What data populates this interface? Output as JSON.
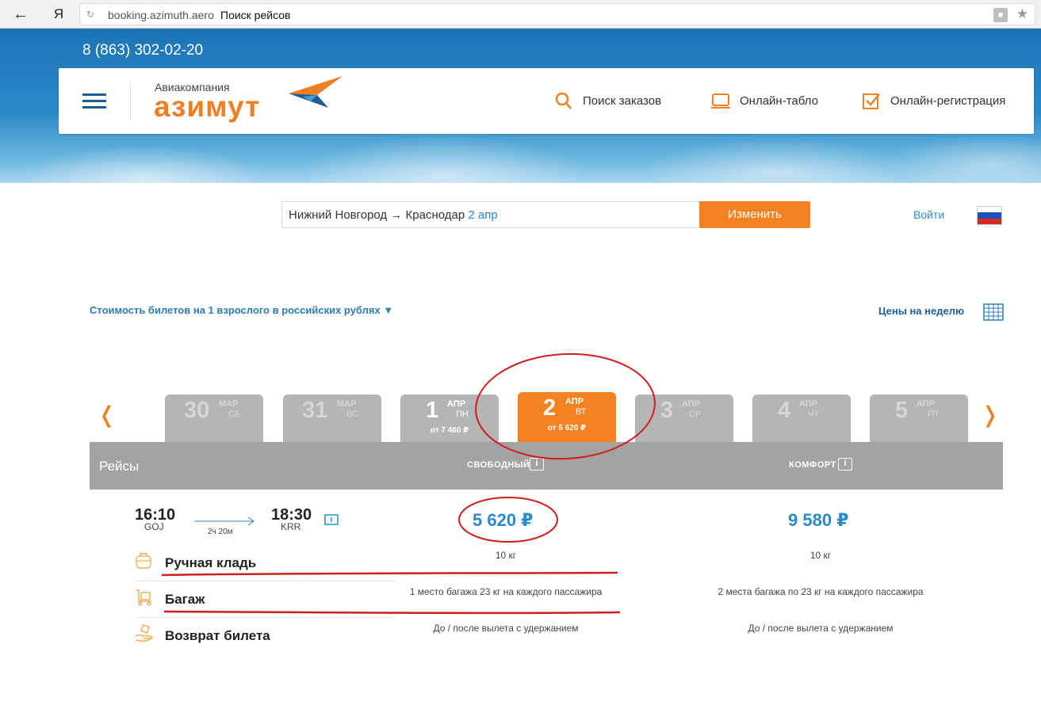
{
  "browser": {
    "back_icon": "arrow-left-icon",
    "yandex_label": "Я",
    "url_domain": "booking.azimuth.aero",
    "url_title": "Поиск рейсов"
  },
  "header": {
    "phone": "8 (863) 302-02-20",
    "logo_small": "Авиакомпания",
    "logo_big": "азимут",
    "nav": [
      {
        "label": "Поиск заказов",
        "icon": "search-icon"
      },
      {
        "label": "Онлайн-табло",
        "icon": "monitor-icon"
      },
      {
        "label": "Онлайн-регистрация",
        "icon": "checkbox-icon"
      }
    ]
  },
  "search": {
    "route": "Нижний Новгород → Краснодар",
    "date": "2 апр",
    "change_label": "Изменить",
    "login_label": "Войти"
  },
  "prices_note": "Стоимость билетов на 1 взрослого в российских рублях",
  "prices_note_arrow": "▼",
  "week_prices_label": "Цены на неделю",
  "nav_arrows": {
    "left": "❬",
    "right": "❭"
  },
  "dates": [
    {
      "day": "30",
      "month": "МАР",
      "weekday": "СБ",
      "price": ""
    },
    {
      "day": "31",
      "month": "МАР",
      "weekday": "ВС",
      "price": ""
    },
    {
      "day": "1",
      "month": "АПР",
      "weekday": "ПН",
      "price": "от 7 460 ₽"
    },
    {
      "day": "2",
      "month": "АПР",
      "weekday": "ВТ",
      "price": "от 5 620 ₽"
    },
    {
      "day": "3",
      "month": "АПР",
      "weekday": "СР",
      "price": ""
    },
    {
      "day": "4",
      "month": "АПР",
      "weekday": "ЧТ",
      "price": ""
    },
    {
      "day": "5",
      "month": "АПР",
      "weekday": "ПТ",
      "price": ""
    }
  ],
  "table": {
    "flights_label": "Рейсы",
    "free_label": "СВОБОДНЫЙ",
    "comfort_label": "КОМФОРТ",
    "info_glyph": "i"
  },
  "flight": {
    "dep_time": "16:10",
    "dep_code": "GOJ",
    "arr_time": "18:30",
    "arr_code": "KRR",
    "duration": "2ч 20м",
    "price_free": "5 620 ₽",
    "price_comfort": "9 580 ₽"
  },
  "features": [
    {
      "label": "Ручная кладь",
      "icon": "bag-icon",
      "free": "10 кг",
      "comfort": "10 кг"
    },
    {
      "label": "Багаж",
      "icon": "luggage-cart-icon",
      "free": "1 место багажа 23 кг на каждого пассажира",
      "comfort": "2 места багажа по 23 кг на каждого пассажира"
    },
    {
      "label": "Возврат билета",
      "icon": "refund-hand-icon",
      "free": "До / после вылета с удержанием",
      "comfort": "До / после вылета с удержанием"
    }
  ],
  "colors": {
    "accent_orange": "#f58220",
    "link_blue": "#2a8bc7",
    "header_gray": "#a3a3a3",
    "annotation_red": "#cc1f1f"
  }
}
